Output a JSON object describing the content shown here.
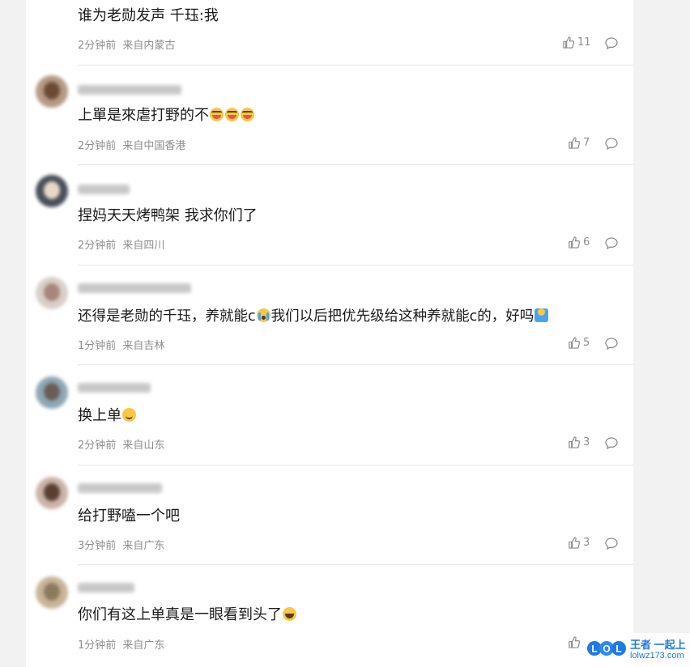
{
  "comments": [
    {
      "text": "谁为老勋发声 千珏:我",
      "time": "2分钟前",
      "location": "来自内蒙古",
      "likes": "11",
      "avatar_colors": [
        "#c9c9c9",
        "#9a8a82"
      ],
      "name_blur_width": 0,
      "emojis": []
    },
    {
      "text": "上單是來虐打野的不",
      "time": "2分钟前",
      "location": "来自中国香港",
      "likes": "7",
      "avatar_colors": [
        "#b69a85",
        "#6b4a36"
      ],
      "name_blur_width": 128,
      "emojis": [
        "cry-icon",
        "cry-icon",
        "cry-icon"
      ]
    },
    {
      "text": "捏妈天天烤鸭架 我求你们了",
      "time": "2分钟前",
      "location": "来自四川",
      "likes": "6",
      "avatar_colors": [
        "#4a4f5a",
        "#e7d9c8"
      ],
      "name_blur_width": 64,
      "emojis": []
    },
    {
      "text_a": "还得是老勋的千珏，养就能c",
      "text_b": "我们以后把优先级给这种养就能c的，好吗",
      "time": "1分钟前",
      "location": "来自吉林",
      "likes": "5",
      "avatar_colors": [
        "#d9cfc9",
        "#a8857a"
      ],
      "name_blur_width": 140,
      "emojis": [
        "sob-icon",
        "shrug-icon"
      ]
    },
    {
      "text": "换上单",
      "time": "2分钟前",
      "location": "来自山东",
      "likes": "3",
      "avatar_colors": [
        "#8fa7b5",
        "#6a5d57"
      ],
      "name_blur_width": 90,
      "emojis": [
        "smile-icon"
      ]
    },
    {
      "text": "给打野嗑一个吧",
      "time": "3分钟前",
      "location": "来自广东",
      "likes": "3",
      "avatar_colors": [
        "#cbb3a8",
        "#5a3f35"
      ],
      "name_blur_width": 104,
      "emojis": []
    },
    {
      "text": "你们有这上单真是一眼看到头了",
      "time": "1分钟前",
      "location": "来自广东",
      "likes": "",
      "avatar_colors": [
        "#c8b49a",
        "#8c7a5e"
      ],
      "name_blur_width": 70,
      "emojis": [
        "lol-icon"
      ]
    }
  ],
  "watermark": {
    "logo": "LOL",
    "line1": "王者 一起上",
    "line2": "lolwz173.com",
    "color": "#1f7ae0"
  }
}
